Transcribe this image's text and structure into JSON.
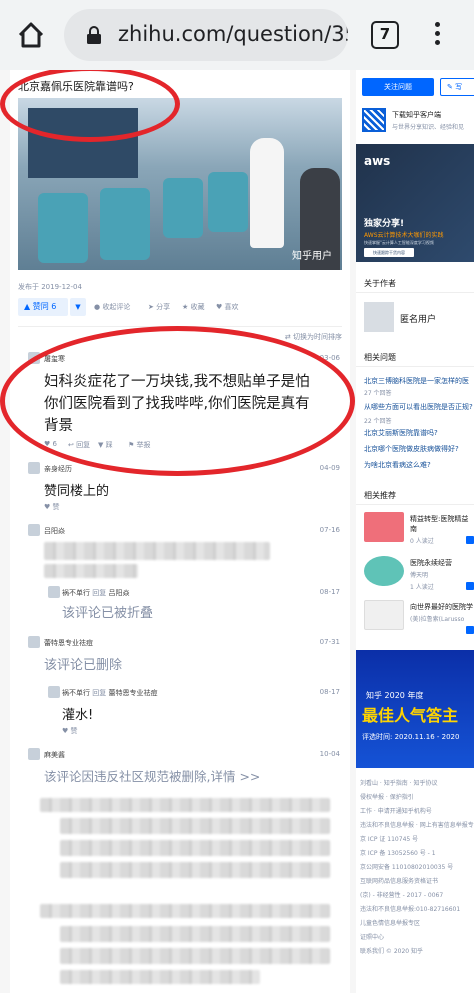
{
  "browser": {
    "url": "zhihu.com/question/35",
    "tab_count": "7"
  },
  "question": {
    "title": "北京嘉佩乐医院靠谱吗?",
    "photo_watermark": "知乎用户",
    "date": "发布于 2019-12-04",
    "vote_label": "▲ 赞同 6",
    "vote_down": "▼",
    "actions": [
      "收起评论",
      "分享",
      "收藏",
      "喜欢"
    ]
  },
  "comments_header": {
    "toggle": "⇄ 切换为时间排序"
  },
  "comments": [
    {
      "name": "屠玺寒",
      "date": "03-06",
      "text_lines": [
        "妇科炎症花了一万块钱,我不想贴单子是怕",
        "你们医院看到了找我哔哔,你们医院是真有",
        "背景"
      ],
      "foot": [
        "6",
        "回复",
        "踩",
        "举报"
      ]
    },
    {
      "name": "亲身经历",
      "date": "04-09",
      "text": "赞同楼上的",
      "foot": "赞"
    },
    {
      "name": "吕阳焱",
      "date": "07-16"
    },
    {
      "name": "祸不单行",
      "reply": "回复",
      "target": "吕阳焱",
      "date": "08-17",
      "text": "该评论已被折叠"
    },
    {
      "name": "蕾特恩专业祛痘",
      "date": "07-31",
      "text": "该评论已删除"
    },
    {
      "name": "祸不单行",
      "reply": "回复",
      "target": "蕾特恩专业祛痘",
      "date": "08-17",
      "text": "灌水!",
      "foot": "赞"
    },
    {
      "name": "麻美酱",
      "date": "10-04",
      "text": "该评论因违反社区规范被删除,详情 >>"
    }
  ],
  "sidebar": {
    "follow_button": "关注问题",
    "write_button": "写",
    "download_title": "下载知乎客户端",
    "download_sub": "与世界分享知识、经验和见",
    "ad": {
      "logo": "aws",
      "title": "独家分享!",
      "subtitle": "AWS云计算技术大咖们的实践",
      "desc": "快速掌握\"云计算人工智能深度学习视频",
      "button": "快速跟踪干货内容"
    },
    "author_heading": "关于作者",
    "author_name": "匿名用户",
    "related_heading": "相关问题",
    "related": [
      {
        "q": "北京三博脑科医院是一家怎样的医",
        "n": "27 个回答"
      },
      {
        "q": "从哪些方面可以看出医院是否正规?",
        "n": ""
      },
      {
        "q": "北京艾丽斯医院靠谱吗?",
        "n": "22 个回答"
      },
      {
        "q": "北京哪个医院做皮肤病做得好?",
        "n": "5 个回答"
      },
      {
        "q": "为啥北京看病这么难?",
        "n": "40 个回答"
      }
    ],
    "recommend_heading": "相关推荐",
    "recommend": [
      {
        "title": "精益转型:医院精益",
        "title2": "南",
        "sub": "0 人读过",
        "color": "#ef6f7a"
      },
      {
        "title": "医院永续经营",
        "title2": "傅天明",
        "sub": "1 人读过",
        "color": "#5fc3b7"
      },
      {
        "title": "向世界最好的医院学",
        "title2": "(美)拉鲁索(Larusso",
        "sub": "",
        "color": "#f0f0f0"
      }
    ],
    "banner": {
      "top": "知乎 2020 年度",
      "big": "最佳人气答主",
      "date": "评选时间: 2020.11.16 - 2020"
    },
    "footer": [
      "刘看山 · 知乎指南 · 知乎协议",
      "侵权举报 · 保护指引",
      "工作 · 申请开通知乎机构号",
      "违法和不良信息举报 · 网上有害信息举报专区",
      "京 ICP 证 110745 号",
      "京 ICP 备 13052560 号 - 1",
      "京公网安备 11010802010035 号",
      "互联网药品信息服务资格证书",
      "(京) - 非经营性 - 2017 - 0067",
      "违法和不良信息举报:010-82716601",
      "儿童色情信息举报专区",
      "证照中心",
      "联系我们 © 2020 知乎"
    ]
  }
}
